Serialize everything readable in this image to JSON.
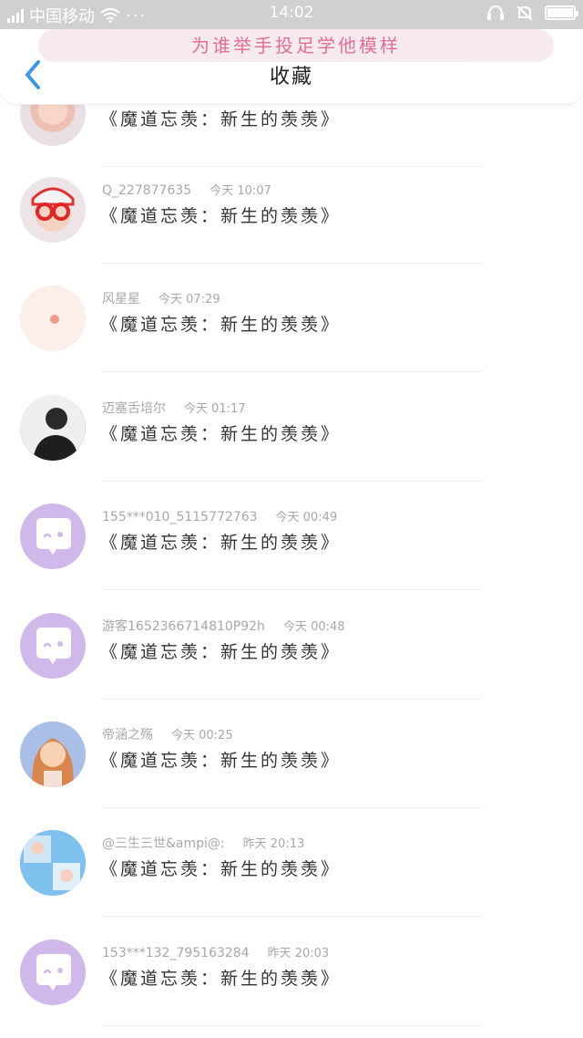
{
  "status_bar": {
    "carrier": "中国移动",
    "dots": "···",
    "time": "14:02"
  },
  "header": {
    "banner_text": "为谁举手投足学他模样",
    "title": "收藏"
  },
  "icons": {
    "back": "chevron-left-icon",
    "signal": "signal-icon",
    "wifi": "wifi-icon",
    "headset": "headset-icon",
    "mute": "bell-off-icon",
    "battery": "battery-icon",
    "default_avatar": "chat-bubble-avatar-icon"
  },
  "colors": {
    "accent_blue": "#3a98e8",
    "default_avatar_bg": "#cfb8ea",
    "banner_text": "#e0608c",
    "meta_text": "#a8a8a8"
  },
  "items": [
    {
      "name": "",
      "time": "",
      "message": "《魔道忘羡：新生的羡羡》",
      "avatar": "photo1"
    },
    {
      "name": "Q_227877635",
      "time": "今天 10:07",
      "message": "《魔道忘羡：新生的羡羡》",
      "avatar": "photo1"
    },
    {
      "name": "风星星",
      "time": "今天 07:29",
      "message": "《魔道忘羡：新生的羡羡》",
      "avatar": "photo2"
    },
    {
      "name": "迈塞舌培尔",
      "time": "今天 01:17",
      "message": "《魔道忘羡：新生的羡羡》",
      "avatar": "photo3"
    },
    {
      "name": "155***010_5115772763",
      "time": "今天 00:49",
      "message": "《魔道忘羡：新生的羡羡》",
      "avatar": "default"
    },
    {
      "name": "游客1652366714810P92h",
      "time": "今天 00:48",
      "message": "《魔道忘羡：新生的羡羡》",
      "avatar": "default"
    },
    {
      "name": "帝涵之殇",
      "time": "今天 00:25",
      "message": "《魔道忘羡：新生的羡羡》",
      "avatar": "photo4"
    },
    {
      "name": "@三生三世&ampi@:",
      "time": "昨天 20:13",
      "message": "《魔道忘羡：新生的羡羡》",
      "avatar": "photo5"
    },
    {
      "name": "153***132_795163284",
      "time": "昨天 20:03",
      "message": "《魔道忘羡：新生的羡羡》",
      "avatar": "default"
    }
  ]
}
